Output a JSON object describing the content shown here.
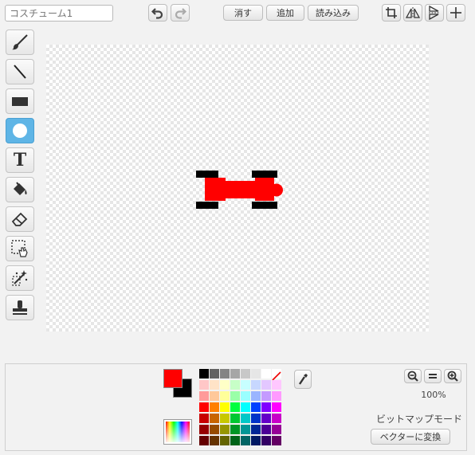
{
  "costume": {
    "name": "",
    "placeholder": "コスチューム1"
  },
  "toolbar": {
    "clear_label": "消す",
    "add_label": "追加",
    "import_label": "読み込み",
    "undo_icon": "undo-icon",
    "redo_icon": "redo-icon",
    "crop_icon": "crop-icon",
    "flip_horizontal_icon": "flip-horizontal-icon",
    "flip_vertical_icon": "flip-vertical-icon",
    "center_icon": "crosshair-icon"
  },
  "tools": [
    {
      "name": "brush",
      "icon": "brush-icon",
      "active": false
    },
    {
      "name": "line",
      "icon": "line-icon",
      "active": false
    },
    {
      "name": "rectangle",
      "icon": "rectangle-icon",
      "active": false
    },
    {
      "name": "ellipse",
      "icon": "ellipse-icon",
      "active": true
    },
    {
      "name": "text",
      "icon": "text-icon",
      "label": "T",
      "active": false
    },
    {
      "name": "fill",
      "icon": "fill-bucket-icon",
      "active": false
    },
    {
      "name": "eraser",
      "icon": "eraser-icon",
      "active": false
    },
    {
      "name": "select",
      "icon": "select-icon",
      "active": false
    },
    {
      "name": "select-remove-background",
      "icon": "magic-wand-icon",
      "active": false
    },
    {
      "name": "stamp",
      "icon": "stamp-icon",
      "active": false
    }
  ],
  "colors": {
    "foreground": "#ff0000",
    "background": "#000000",
    "accent_tool": "#5fb5e6",
    "car_body": "#ff0000",
    "car_wheels": "#000000"
  },
  "palette": [
    [
      "#000000",
      "#626262",
      "#848484",
      "#a6a6a6",
      "#c8c8c8",
      "#e6e6e6",
      "#ffffff",
      "transparent"
    ],
    [
      "#ffc7c7",
      "#ffe3c7",
      "#ffffc7",
      "#c7ffc7",
      "#c7ffff",
      "#c7d7ff",
      "#e3c7ff",
      "#ffc7ff"
    ],
    [
      "#ff9a9a",
      "#ffc89a",
      "#ffff9a",
      "#9affa8",
      "#9affff",
      "#9ab5ff",
      "#c49aff",
      "#ff9aff"
    ],
    [
      "#ff0000",
      "#ff8000",
      "#ffff00",
      "#00ff40",
      "#00ffff",
      "#0040ff",
      "#8000ff",
      "#ff00ff"
    ],
    [
      "#c80000",
      "#c86400",
      "#c8c800",
      "#00c832",
      "#00c8c8",
      "#0032c8",
      "#6400c8",
      "#c800c8"
    ],
    [
      "#960000",
      "#964b00",
      "#969600",
      "#009626",
      "#009696",
      "#002696",
      "#4b0096",
      "#960096"
    ],
    [
      "#640000",
      "#643200",
      "#646400",
      "#006419",
      "#006464",
      "#001964",
      "#320064",
      "#640064"
    ]
  ],
  "zoom": {
    "value": "100%",
    "zoom_out_icon": "zoom-out-icon",
    "reset_icon": "zoom-reset-icon",
    "zoom_in_icon": "zoom-in-icon"
  },
  "mode": {
    "label": "ビットマップモード",
    "convert_label": "ベクターに変換"
  }
}
